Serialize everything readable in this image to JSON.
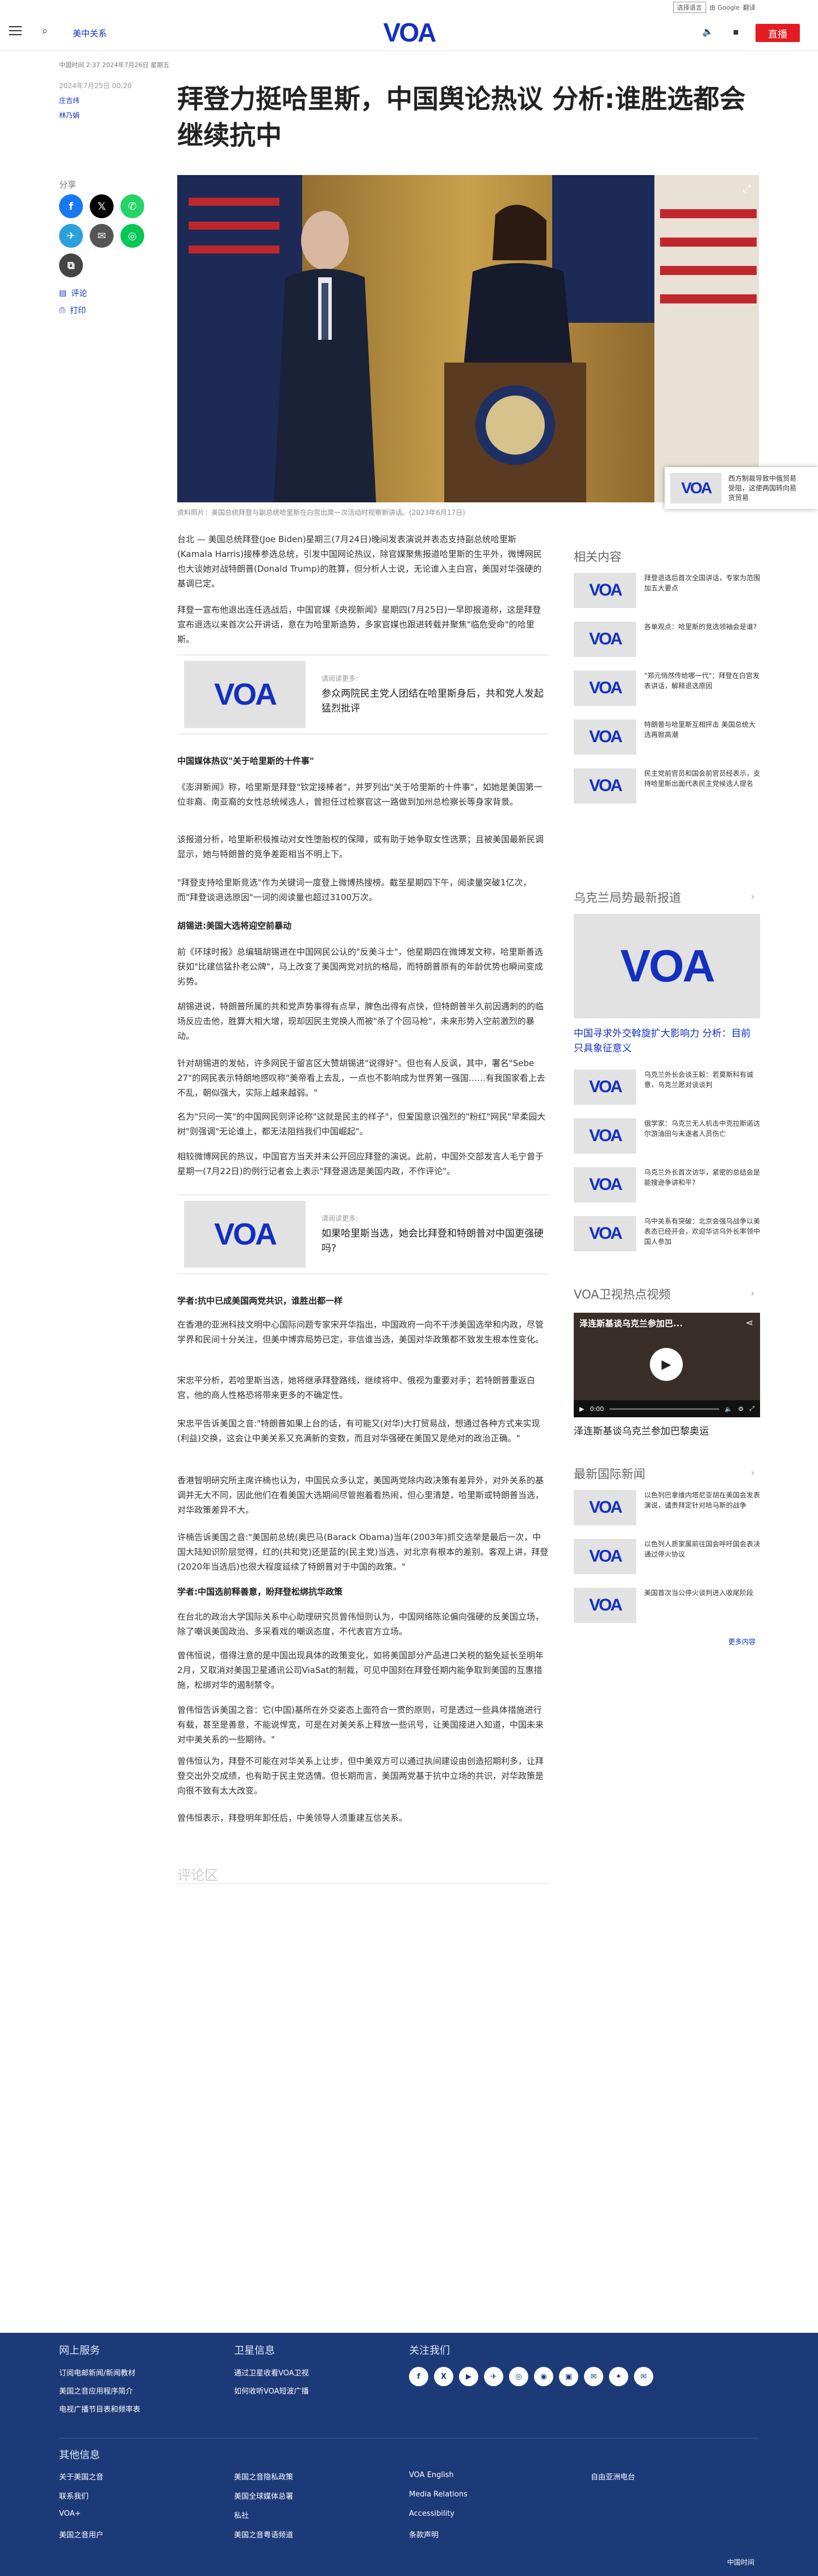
{
  "util": {
    "lang_select": "选择语言",
    "google": "由 Google",
    "translate": "翻译"
  },
  "header": {
    "section": "美中关系",
    "logo": "VOA",
    "live": "直播"
  },
  "meta": {
    "timezone": "中国时间 2:37 2024年7月26日 星期五",
    "date": "2024年7月25日 00:20",
    "author1": "庄吉纬",
    "author2": "林乃娟"
  },
  "article": {
    "title": "拜登力挺哈里斯，中国舆论热议 分析:谁胜选都会继续抗中",
    "caption": "资料照片：美国总统拜登与副总统哈里斯在白宫出席一次活动时视察新讲话。(2023年6月17日)",
    "p1": "台北 — 美国总统拜登(Joe Biden)星期三(7月24日)晚间发表演说并表态支持副总统哈里斯(Kamala Harris)接棒参选总统，引发中国网论热议，除官媒聚焦报道哈里斯的生平外，微博网民也大谈她对战特朗普(Donald Trump)的胜算，但分析人士说，无论谁入主白宫，美国对华强硬的基调已定。",
    "p2": "拜登一宣布他退出连任选战后，中国官媒《央视新闻》星期四(7月25日)一早即报道称，这是拜登宣布退选以来首次公开讲话，意在为哈里斯造势，多家官媒也跟进转载并聚焦\"临危受命\"的哈里斯。",
    "r1_label": "请阅读更多:",
    "r1_title": "参众两院民主党人团结在哈里斯身后，共和党人发起猛烈批评",
    "h1": "中国媒体热议\"关于哈里斯的十件事\"",
    "p3": "《澎湃新闻》称，哈里斯是拜登\"钦定接棒者\"，并罗列出\"关于哈里斯的十件事\"，如她是美国第一位非裔、南亚裔的女性总统候选人，曾担任过检察官这一路做到加州总检察长等身家背景。",
    "p4": "该报道分析，哈里斯积极推动对女性堕胎权的保障，或有助于她争取女性选票；且被美国最新民调显示，她与特朗普的竞争差距相当不明上下。",
    "p5": "\"拜登支持哈里斯竞选\"作为关键词一度登上微博热搜榜。截至星期四下午，阅读量突破1亿次，而\"拜登谈退选原因\"一词的阅读量也超过3100万次。",
    "h2": "胡锡进:美国大选将迎空前暴动",
    "p6": "前《环球时报》总编辑胡锡进在中国网民公认的\"反美斗士\"，他星期四在微博发文称，哈里斯善选获如\"比建信猛扑老公牌\"，马上改变了美国两党对抗的格局，而特朗普原有的年龄优势也瞬间变成劣势。",
    "p7": "胡锡进说，特朗普所属的共和党声势事得有点早，脾色出得有点快，但特朗普半久前因遇刺的的临场反应击他，胜算大相大增，现却因民主党换人而被\"杀了个回马枪\"，未来形势入空前激烈的暴动。",
    "p8": "针对胡锡进的发帖，许多网民于留言区大赞胡锡进\"说得好\"。但也有人反讽，其中，署名\"Sebe 27\"的网民表示特朗地感叹称\"美帝看上去乱，一点也不影响成为世界第一强国……有我国家看上去不乱，朝似强大，实际上越来越弱。\"",
    "p9": "名为\"只问一笑\"的中国网民则评论称\"这就是民主的样子\"，但爱国意识强烈的\"粉红\"网民\"早柔园大树\"则强调\"无论谁上，都无法阻挡我们中国崛起\"。",
    "p10": "相较微博网民的热议，中国官方当天并未公开回应拜登的演说。此前，中国外交部发言人毛宁曾于星期一(7月22日)的例行记者会上表示\"拜登退选是美国内政，不作评论\"。",
    "r2_label": "请阅读更多:",
    "r2_title": "如果哈里斯当选，她会比拜登和特朗普对中国更强硬吗?",
    "h3": "学者:抗中已成美国两党共识，谁胜出都一样",
    "p11": "在香港的亚洲科技文明中心国际问题专家宋开华指出，中国政府一向不干涉美国选举和内政，尽管学界和民间十分关注，但美中博弈局势已定，非信谁当选，美国对华政策都不致发生根本性变化。",
    "p12": "宋忠平分析，若哈里斯当选，她将继承拜登路线，继续将中、俄视为重要对手；若特朗普重返白宫，他的商人性格恐将带来更多的不确定性。",
    "p13": "宋忠平告诉美国之音:\"特朗普如果上台的话，有可能又(对华)大打贸易战，想通过各种方式来实现(利益)交换，这会让中美关系又充满新的变数，而且对华强硬在美国又是绝对的政治正确。\"",
    "p14": "香港智明研究所主席许楠也认为，中国民众多认定，美国两党除内政决策有差异外，对外关系的基调并无大不同，因此他们在看美国大选期间尽管抱着看热闹，但心里清楚，哈里斯或特朗普当选，对华政策差异不大。",
    "p15": "许楠告诉美国之音:\"美国前总统(奥巴马(Barack Obama)当年(2003年)抓交选举是最后一次，中国大陆知识阶层觉得，红的(共和党)还是蓝的(民主党)当选，对北京有根本的差别。客观上讲，拜登(2020年当选后)也很大程度延续了特朗普对于中国的政策。\"",
    "h4": "学者:中国选前释善意，盼拜登松绑抗华政策",
    "p16": "在台北的政治大学国际关系中心助理研究员曾伟恒则认为，中国网络陈论偏向强硬的反美国立场，除了嘲讽美国政治、多采看戏的嘲讽态度，不代表官方立场。",
    "p17": "曾伟恒说，借得注意的是中国出现具体的政策变化，如将美国部分产品进口关税的豁免延长至明年2月，又取消对美国卫星通讯公司ViaSat的制裁，可见中国刻在拜登任期内能争取到美国的互惠措施，松绑对华的遏制禁令。",
    "p18": "曾伟恒告诉美国之音：它(中国)基所在外交姿态上面符合一贯的原则，可是透过一些具体措施进行有载，甚至是善意，不能说悍宽，可是在对美关系上释放一些讯号，让美国接进入知道，中国未来对中美关系的一些期待。\"",
    "p19": "曾伟恒认为，拜登不可能在对华关系上让步，但中美双方可以通过执间建设由创造招期利多，让拜登交出外交成绩，也有助于民主党选情。但长期而言，美国两党基于抗中立场的共识，对华政策是向很不致有太大改变。",
    "p20": "曾伟恒表示，拜登明年卸任后，中美领导人须重建互信关系。",
    "comments": "评论区"
  },
  "share": {
    "label": "分享",
    "comments": "评论",
    "print": "打印"
  },
  "float_card": {
    "title": "西方制裁导致中俄贸易受阻，这使两国转向易货贸易"
  },
  "sidebar": {
    "related_title": "相关内容",
    "related": [
      "拜登退选后首次全国讲话，专家为范围加五大要点",
      "各单观点：哈里斯的竞选领袖会是谁?",
      "\"郑元悄然传给哪一代\"：拜登在白宫发表讲话，解释退选原因",
      "特朗普与哈里斯互相抨击 美国总统大选再掀高潮",
      "民主党前官员和国会前官员经表示，支持哈里斯出面代表民主党候选人提名"
    ],
    "ukraine_title": "乌克兰局势最新报道",
    "ukraine_feature": "中国寻求外交斡旋扩大影响力 分析：目前只具象征意义",
    "ukraine": [
      "乌克兰外长会谈王毅：若莫斯科有诚意，乌克兰愿对谈谈判",
      "俄学家：乌克兰无人机击中克拉斯诺达尔游油田与未遂者人员伤亡",
      "乌克兰外长首次访华，紧密的总结会是能搜逊争讲和平?",
      "乌中关系有突破：北京会强乌战争以美表态已经开会，欢迎华访乌外长率领中国人参加"
    ],
    "video_title": "VOA卫视热点视频",
    "video_overlay": "泽连斯基谈乌克兰参加巴...",
    "video_time": "0:00",
    "video_caption": "泽连斯基谈乌克兰参加巴黎奥运",
    "news_title": "最新国际新闻",
    "news": [
      "以色列巴拿维内塔尼亚胡在美国会发表演说，谴责拜定针对哈马斯的战争",
      "以色列人质家属前往国会呼吁国会表决通过停火协议",
      "美国首次当公停火谈判进入收尾阶段"
    ],
    "more": "更多内容"
  },
  "footer": {
    "col1_title": "网上服务",
    "col1": [
      "订阅电邮新闻/新闻教材",
      "美国之音应用程序简介",
      "电视广播节目表和频率表"
    ],
    "col2_title": "卫星信息",
    "col2": [
      "通过卫星收看VOA卫视",
      "如何收听VOA短波广播"
    ],
    "col3_title": "关注我们",
    "social": [
      "f",
      "X",
      "▶",
      "✈",
      "◎",
      "◉",
      "▣",
      "✉",
      "✦",
      "✉"
    ],
    "other_title": "其他信息",
    "links": [
      "关于美国之音",
      "联系我们",
      "VOA+",
      "美国之音用户",
      "美国之音隐私政策",
      "美国全球媒体总署",
      "私社",
      "美国之音粤语频道",
      "VOA English",
      "Accessibility",
      "Media Relations",
      "条款声明",
      "自由亚洲电台"
    ],
    "bottom": "中国时间"
  },
  "colors": {
    "brand": "#1330bf",
    "live": "#e41b23",
    "footer": "#1c3a78"
  }
}
